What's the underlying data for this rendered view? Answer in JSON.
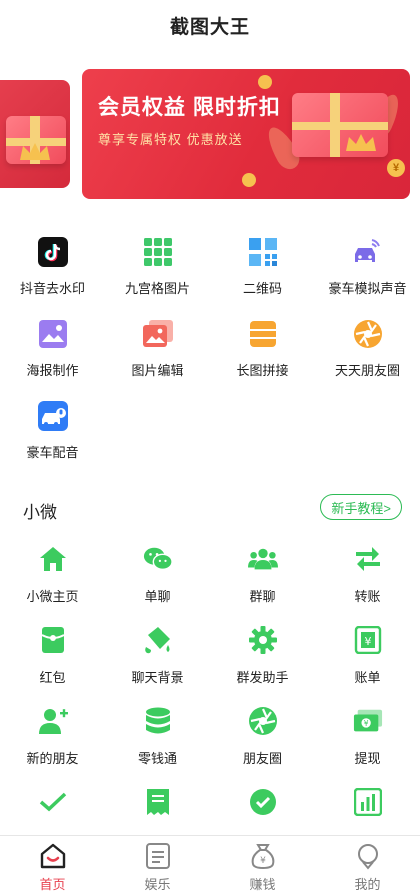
{
  "app": {
    "title": "截图大王"
  },
  "banner": {
    "title": "会员权益 限时折扣",
    "subtitle": "尊享专属特权 优惠放送",
    "coin_symbol": "¥",
    "colors": {
      "background": "#e12c3c",
      "subtitle": "#ffe1a6"
    }
  },
  "tools": [
    {
      "label": "抖音去水印",
      "icon": "tiktok-icon"
    },
    {
      "label": "九宫格图片",
      "icon": "grid-nine-icon"
    },
    {
      "label": "二维码",
      "icon": "qrcode-icon"
    },
    {
      "label": "豪车模拟声音",
      "icon": "car-sound-icon"
    },
    {
      "label": "海报制作",
      "icon": "poster-icon"
    },
    {
      "label": "图片编辑",
      "icon": "image-edit-icon"
    },
    {
      "label": "长图拼接",
      "icon": "long-image-icon"
    },
    {
      "label": "天天朋友圈",
      "icon": "moments-icon"
    },
    {
      "label": "豪车配音",
      "icon": "car-dubbing-icon"
    }
  ],
  "section": {
    "title": "小微",
    "tutorial_label": "新手教程>"
  },
  "wx_tools": [
    {
      "label": "小微主页",
      "icon": "home-icon"
    },
    {
      "label": "单聊",
      "icon": "chat-icon"
    },
    {
      "label": "群聊",
      "icon": "group-icon"
    },
    {
      "label": "转账",
      "icon": "transfer-icon"
    },
    {
      "label": "红包",
      "icon": "red-packet-icon"
    },
    {
      "label": "聊天背景",
      "icon": "paint-bucket-icon"
    },
    {
      "label": "群发助手",
      "icon": "gear-icon"
    },
    {
      "label": "账单",
      "icon": "bill-icon"
    },
    {
      "label": "新的朋友",
      "icon": "add-friend-icon"
    },
    {
      "label": "零钱通",
      "icon": "coins-icon"
    },
    {
      "label": "朋友圈",
      "icon": "aperture-icon"
    },
    {
      "label": "提现",
      "icon": "withdraw-icon"
    },
    {
      "label": "",
      "icon": "check-icon"
    },
    {
      "label": "",
      "icon": "receipt-icon"
    },
    {
      "label": "",
      "icon": "check-circle-icon"
    },
    {
      "label": "",
      "icon": "chart-icon"
    }
  ],
  "tabbar": [
    {
      "label": "首页",
      "icon": "home-tab-icon",
      "active": true
    },
    {
      "label": "娱乐",
      "icon": "document-tab-icon",
      "active": false
    },
    {
      "label": "赚钱",
      "icon": "money-bag-tab-icon",
      "active": false
    },
    {
      "label": "我的",
      "icon": "profile-tab-icon",
      "active": false
    }
  ],
  "colors": {
    "accent_green": "#2dbb55",
    "accent_red": "#e8414f"
  }
}
